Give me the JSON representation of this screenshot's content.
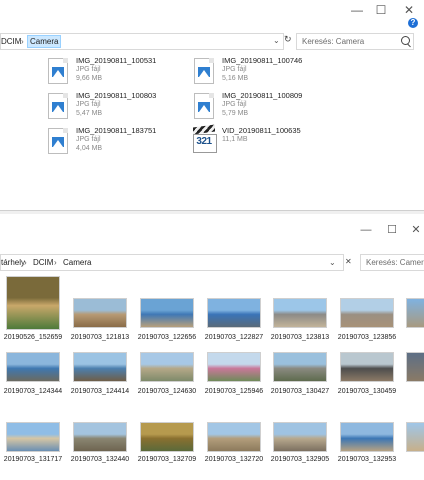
{
  "window1": {
    "caption_buttons": {
      "minimize": "—",
      "maximize": "☐",
      "close": "✕"
    },
    "help": "?",
    "breadcrumb": [
      "DCIM",
      "Camera"
    ],
    "refresh": "↻",
    "dropdown": "⌄",
    "search_placeholder": "Keresés: Camera",
    "files": [
      {
        "name": "IMG_20190811_100531",
        "type": "JPG fájl",
        "size": "9,66 MB",
        "icon": "jpg-file-icon"
      },
      {
        "name": "IMG_20190811_100746",
        "type": "JPG fájl",
        "size": "5,16 MB",
        "icon": "jpg-file-icon"
      },
      {
        "name": "IMG_20190811_100803",
        "type": "JPG fájl",
        "size": "5,47 MB",
        "icon": "jpg-file-icon"
      },
      {
        "name": "IMG_20190811_100809",
        "type": "JPG fájl",
        "size": "5,79 MB",
        "icon": "jpg-file-icon"
      },
      {
        "name": "IMG_20190811_183751",
        "type": "JPG fájl",
        "size": "4,04 MB",
        "icon": "jpg-file-icon"
      },
      {
        "name": "VID_20190811_100635",
        "type": "",
        "size": "11,1 MB",
        "icon": "video-file-icon",
        "icon_text": "321"
      }
    ]
  },
  "window2": {
    "caption_buttons": {
      "minimize": "—",
      "maximize": "☐",
      "close": "✕"
    },
    "breadcrumb": [
      "tárhely",
      "DCIM",
      "Camera"
    ],
    "dropdown": "⌄",
    "close_path": "✕",
    "search_placeholder": "Keresés: Camera",
    "thumbnails": [
      {
        "label": "20190526_152659",
        "colors": [
          "#7a6a3a",
          "#c9a86a",
          "#4e7a3a"
        ]
      },
      {
        "label": "20190703_121813",
        "colors": [
          "#9bbcd6",
          "#b79a74",
          "#8a6c48"
        ]
      },
      {
        "label": "20190703_122656",
        "colors": [
          "#6aa3d4",
          "#3f78b5",
          "#b7a07c"
        ]
      },
      {
        "label": "20190703_122827",
        "colors": [
          "#7fb2e0",
          "#3a74b8",
          "#5a6b7a"
        ]
      },
      {
        "label": "20190703_123813",
        "colors": [
          "#9cc6e8",
          "#8c8a86",
          "#c2b49a"
        ]
      },
      {
        "label": "20190703_123856",
        "colors": [
          "#b2cfe6",
          "#9a8f82",
          "#a89278"
        ]
      },
      {
        "label": "20190703_124344",
        "colors": [
          "#8bb6dc",
          "#3f78b0",
          "#6b6a60"
        ]
      },
      {
        "label": "20190703_124414",
        "colors": [
          "#9bc3e3",
          "#4c7fae",
          "#6f5e48"
        ]
      },
      {
        "label": "20190703_124630",
        "colors": [
          "#a7c8e6",
          "#b5a888",
          "#7e8a6a"
        ]
      },
      {
        "label": "20190703_125946",
        "colors": [
          "#c4d9ec",
          "#c9789a",
          "#6f8a5a"
        ]
      },
      {
        "label": "20190703_130427",
        "colors": [
          "#9ac0dd",
          "#8a8a80",
          "#5e6b4e"
        ]
      },
      {
        "label": "20190703_130459",
        "colors": [
          "#b9c7cf",
          "#4d4d4d",
          "#8b7a66"
        ]
      },
      {
        "label": "20190703_131717",
        "colors": [
          "#8fbde6",
          "#d6c6a4",
          "#6a8fb3"
        ]
      },
      {
        "label": "20190703_132440",
        "colors": [
          "#a4c4df",
          "#8a8672",
          "#6e6450"
        ]
      },
      {
        "label": "20190703_132709",
        "colors": [
          "#b69a4e",
          "#8a7030",
          "#5a6a3a"
        ]
      },
      {
        "label": "20190703_132720",
        "colors": [
          "#a2c6e5",
          "#b39e7c",
          "#8c7a5c"
        ]
      },
      {
        "label": "20190703_132905",
        "colors": [
          "#9fc3e2",
          "#b8a98e",
          "#7c7060"
        ]
      },
      {
        "label": "20190703_132953",
        "colors": [
          "#8eb8df",
          "#3b76b4",
          "#b6a282"
        ]
      }
    ]
  }
}
